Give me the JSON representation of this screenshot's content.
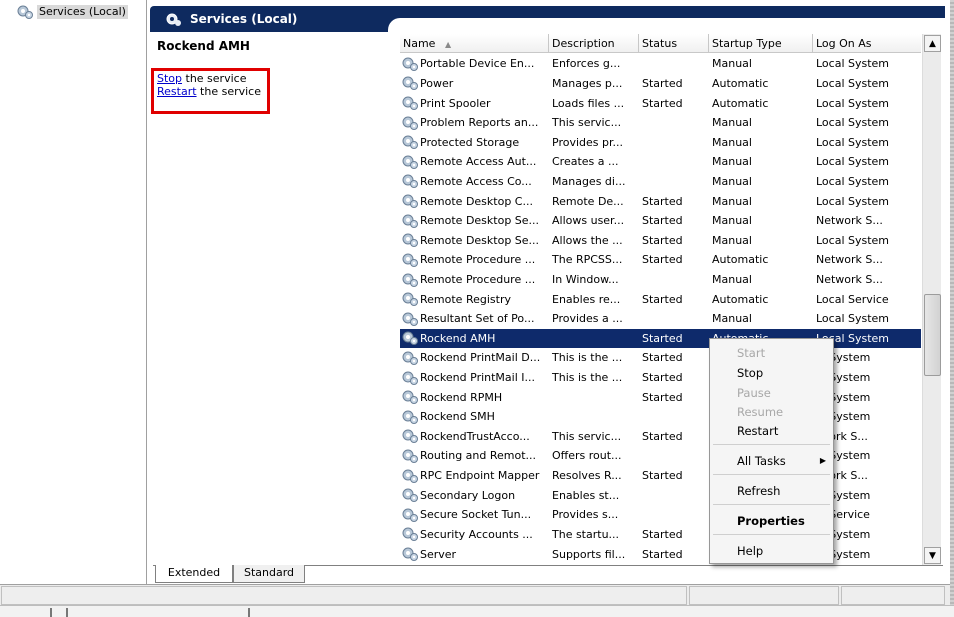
{
  "tree": {
    "root_label": "Services (Local)"
  },
  "header": {
    "title": "Services (Local)"
  },
  "description": {
    "service_name": "Rockend AMH",
    "stop_link": "Stop",
    "stop_rest": " the service",
    "restart_link": "Restart",
    "restart_rest": " the service"
  },
  "columns": {
    "name": "Name",
    "sort_indicator": "▲",
    "description": "Description",
    "status": "Status",
    "startup_type": "Startup Type",
    "log_on_as": "Log On As"
  },
  "services": [
    {
      "name": "Portable Device En...",
      "description": "Enforces g...",
      "status": "",
      "startup_type": "Manual",
      "log_on_as": "Local System"
    },
    {
      "name": "Power",
      "description": "Manages p...",
      "status": "Started",
      "startup_type": "Automatic",
      "log_on_as": "Local System"
    },
    {
      "name": "Print Spooler",
      "description": "Loads files ...",
      "status": "Started",
      "startup_type": "Automatic",
      "log_on_as": "Local System"
    },
    {
      "name": "Problem Reports an...",
      "description": "This servic...",
      "status": "",
      "startup_type": "Manual",
      "log_on_as": "Local System"
    },
    {
      "name": "Protected Storage",
      "description": "Provides pr...",
      "status": "",
      "startup_type": "Manual",
      "log_on_as": "Local System"
    },
    {
      "name": "Remote Access Aut...",
      "description": "Creates a ...",
      "status": "",
      "startup_type": "Manual",
      "log_on_as": "Local System"
    },
    {
      "name": "Remote Access Co...",
      "description": "Manages di...",
      "status": "",
      "startup_type": "Manual",
      "log_on_as": "Local System"
    },
    {
      "name": "Remote Desktop C...",
      "description": "Remote De...",
      "status": "Started",
      "startup_type": "Manual",
      "log_on_as": "Local System"
    },
    {
      "name": "Remote Desktop Se...",
      "description": "Allows user...",
      "status": "Started",
      "startup_type": "Manual",
      "log_on_as": "Network S..."
    },
    {
      "name": "Remote Desktop Se...",
      "description": "Allows the ...",
      "status": "Started",
      "startup_type": "Manual",
      "log_on_as": "Local System"
    },
    {
      "name": "Remote Procedure ...",
      "description": "The RPCSS...",
      "status": "Started",
      "startup_type": "Automatic",
      "log_on_as": "Network S..."
    },
    {
      "name": "Remote Procedure ...",
      "description": "In Window...",
      "status": "",
      "startup_type": "Manual",
      "log_on_as": "Network S..."
    },
    {
      "name": "Remote Registry",
      "description": "Enables re...",
      "status": "Started",
      "startup_type": "Automatic",
      "log_on_as": "Local Service"
    },
    {
      "name": "Resultant Set of Po...",
      "description": "Provides a ...",
      "status": "",
      "startup_type": "Manual",
      "log_on_as": "Local System"
    },
    {
      "name": "Rockend AMH",
      "description": "",
      "status": "Started",
      "startup_type": "Automatic",
      "log_on_as": "Local System",
      "selected": true
    },
    {
      "name": "Rockend PrintMail D...",
      "description": "This is the ...",
      "status": "Started",
      "startup_type": "",
      "log_on_as": "al System"
    },
    {
      "name": "Rockend PrintMail I...",
      "description": "This is the ...",
      "status": "Started",
      "startup_type": "",
      "log_on_as": "al System"
    },
    {
      "name": "Rockend RPMH",
      "description": "",
      "status": "Started",
      "startup_type": "",
      "log_on_as": "al System"
    },
    {
      "name": "Rockend SMH",
      "description": "",
      "status": "",
      "startup_type": "",
      "log_on_as": "al System"
    },
    {
      "name": "RockendTrustAcco...",
      "description": "This servic...",
      "status": "Started",
      "startup_type": "",
      "log_on_as": "twork S..."
    },
    {
      "name": "Routing and Remot...",
      "description": "Offers rout...",
      "status": "",
      "startup_type": "",
      "log_on_as": "al System"
    },
    {
      "name": "RPC Endpoint Mapper",
      "description": "Resolves R...",
      "status": "Started",
      "startup_type": "",
      "log_on_as": "twork S..."
    },
    {
      "name": "Secondary Logon",
      "description": "Enables st...",
      "status": "",
      "startup_type": "",
      "log_on_as": "al System"
    },
    {
      "name": "Secure Socket Tun...",
      "description": "Provides s...",
      "status": "",
      "startup_type": "",
      "log_on_as": "al Service"
    },
    {
      "name": "Security Accounts ...",
      "description": "The startu...",
      "status": "Started",
      "startup_type": "",
      "log_on_as": "al System"
    },
    {
      "name": "Server",
      "description": "Supports fil...",
      "status": "Started",
      "startup_type": "",
      "log_on_as": "al System"
    }
  ],
  "context_menu": {
    "start": "Start",
    "stop": "Stop",
    "pause": "Pause",
    "resume": "Resume",
    "restart": "Restart",
    "all_tasks": "All Tasks",
    "all_tasks_arrow": "▶",
    "refresh": "Refresh",
    "properties": "Properties",
    "help": "Help"
  },
  "tabs": {
    "extended": "Extended",
    "standard": "Standard"
  },
  "scrollbar": {
    "up_arrow": "▲",
    "down_arrow": "▼"
  },
  "colors": {
    "header_bg": "#0e2a5f",
    "selected_row": "#0e2a6b",
    "link": "#0000cc",
    "highlight_box": "#e00000"
  }
}
